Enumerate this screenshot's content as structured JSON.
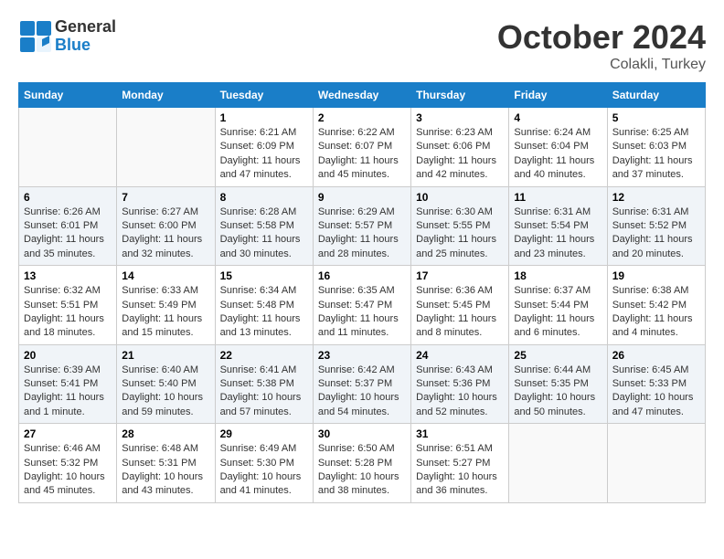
{
  "header": {
    "logo_general": "General",
    "logo_blue": "Blue",
    "title": "October 2024",
    "location": "Colakli, Turkey"
  },
  "weekdays": [
    "Sunday",
    "Monday",
    "Tuesday",
    "Wednesday",
    "Thursday",
    "Friday",
    "Saturday"
  ],
  "weeks": [
    [
      {
        "day": "",
        "info": ""
      },
      {
        "day": "",
        "info": ""
      },
      {
        "day": "1",
        "info": "Sunrise: 6:21 AM\nSunset: 6:09 PM\nDaylight: 11 hours and 47 minutes."
      },
      {
        "day": "2",
        "info": "Sunrise: 6:22 AM\nSunset: 6:07 PM\nDaylight: 11 hours and 45 minutes."
      },
      {
        "day": "3",
        "info": "Sunrise: 6:23 AM\nSunset: 6:06 PM\nDaylight: 11 hours and 42 minutes."
      },
      {
        "day": "4",
        "info": "Sunrise: 6:24 AM\nSunset: 6:04 PM\nDaylight: 11 hours and 40 minutes."
      },
      {
        "day": "5",
        "info": "Sunrise: 6:25 AM\nSunset: 6:03 PM\nDaylight: 11 hours and 37 minutes."
      }
    ],
    [
      {
        "day": "6",
        "info": "Sunrise: 6:26 AM\nSunset: 6:01 PM\nDaylight: 11 hours and 35 minutes."
      },
      {
        "day": "7",
        "info": "Sunrise: 6:27 AM\nSunset: 6:00 PM\nDaylight: 11 hours and 32 minutes."
      },
      {
        "day": "8",
        "info": "Sunrise: 6:28 AM\nSunset: 5:58 PM\nDaylight: 11 hours and 30 minutes."
      },
      {
        "day": "9",
        "info": "Sunrise: 6:29 AM\nSunset: 5:57 PM\nDaylight: 11 hours and 28 minutes."
      },
      {
        "day": "10",
        "info": "Sunrise: 6:30 AM\nSunset: 5:55 PM\nDaylight: 11 hours and 25 minutes."
      },
      {
        "day": "11",
        "info": "Sunrise: 6:31 AM\nSunset: 5:54 PM\nDaylight: 11 hours and 23 minutes."
      },
      {
        "day": "12",
        "info": "Sunrise: 6:31 AM\nSunset: 5:52 PM\nDaylight: 11 hours and 20 minutes."
      }
    ],
    [
      {
        "day": "13",
        "info": "Sunrise: 6:32 AM\nSunset: 5:51 PM\nDaylight: 11 hours and 18 minutes."
      },
      {
        "day": "14",
        "info": "Sunrise: 6:33 AM\nSunset: 5:49 PM\nDaylight: 11 hours and 15 minutes."
      },
      {
        "day": "15",
        "info": "Sunrise: 6:34 AM\nSunset: 5:48 PM\nDaylight: 11 hours and 13 minutes."
      },
      {
        "day": "16",
        "info": "Sunrise: 6:35 AM\nSunset: 5:47 PM\nDaylight: 11 hours and 11 minutes."
      },
      {
        "day": "17",
        "info": "Sunrise: 6:36 AM\nSunset: 5:45 PM\nDaylight: 11 hours and 8 minutes."
      },
      {
        "day": "18",
        "info": "Sunrise: 6:37 AM\nSunset: 5:44 PM\nDaylight: 11 hours and 6 minutes."
      },
      {
        "day": "19",
        "info": "Sunrise: 6:38 AM\nSunset: 5:42 PM\nDaylight: 11 hours and 4 minutes."
      }
    ],
    [
      {
        "day": "20",
        "info": "Sunrise: 6:39 AM\nSunset: 5:41 PM\nDaylight: 11 hours and 1 minute."
      },
      {
        "day": "21",
        "info": "Sunrise: 6:40 AM\nSunset: 5:40 PM\nDaylight: 10 hours and 59 minutes."
      },
      {
        "day": "22",
        "info": "Sunrise: 6:41 AM\nSunset: 5:38 PM\nDaylight: 10 hours and 57 minutes."
      },
      {
        "day": "23",
        "info": "Sunrise: 6:42 AM\nSunset: 5:37 PM\nDaylight: 10 hours and 54 minutes."
      },
      {
        "day": "24",
        "info": "Sunrise: 6:43 AM\nSunset: 5:36 PM\nDaylight: 10 hours and 52 minutes."
      },
      {
        "day": "25",
        "info": "Sunrise: 6:44 AM\nSunset: 5:35 PM\nDaylight: 10 hours and 50 minutes."
      },
      {
        "day": "26",
        "info": "Sunrise: 6:45 AM\nSunset: 5:33 PM\nDaylight: 10 hours and 47 minutes."
      }
    ],
    [
      {
        "day": "27",
        "info": "Sunrise: 6:46 AM\nSunset: 5:32 PM\nDaylight: 10 hours and 45 minutes."
      },
      {
        "day": "28",
        "info": "Sunrise: 6:48 AM\nSunset: 5:31 PM\nDaylight: 10 hours and 43 minutes."
      },
      {
        "day": "29",
        "info": "Sunrise: 6:49 AM\nSunset: 5:30 PM\nDaylight: 10 hours and 41 minutes."
      },
      {
        "day": "30",
        "info": "Sunrise: 6:50 AM\nSunset: 5:28 PM\nDaylight: 10 hours and 38 minutes."
      },
      {
        "day": "31",
        "info": "Sunrise: 6:51 AM\nSunset: 5:27 PM\nDaylight: 10 hours and 36 minutes."
      },
      {
        "day": "",
        "info": ""
      },
      {
        "day": "",
        "info": ""
      }
    ]
  ]
}
